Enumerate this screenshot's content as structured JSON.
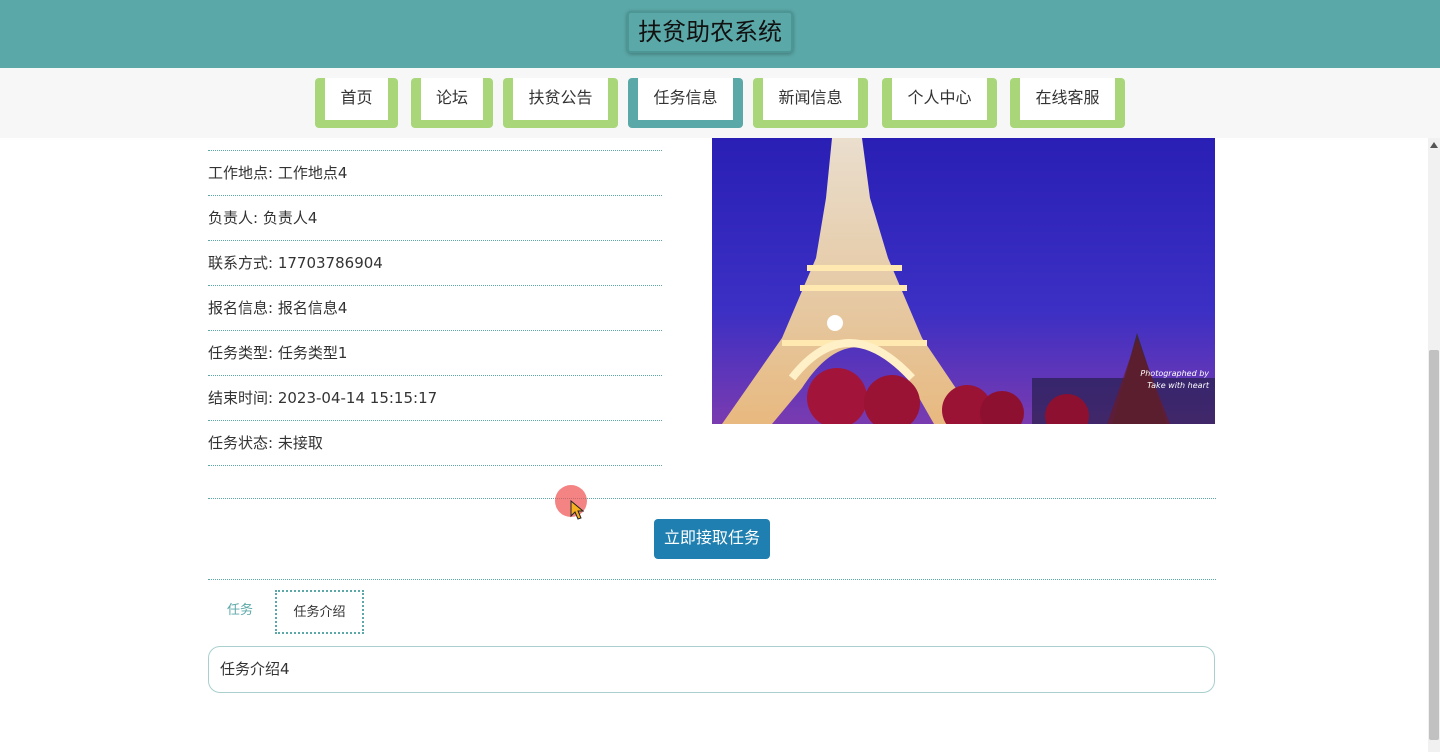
{
  "header": {
    "title": "扶贫助农系统"
  },
  "nav": {
    "items": [
      {
        "label": "首页",
        "active": false
      },
      {
        "label": "论坛",
        "active": false
      },
      {
        "label": "扶贫公告",
        "active": false
      },
      {
        "label": "任务信息",
        "active": true
      },
      {
        "label": "新闻信息",
        "active": false
      },
      {
        "label": "个人中心",
        "active": false
      },
      {
        "label": "在线客服",
        "active": false
      }
    ]
  },
  "task": {
    "fields": [
      {
        "label": "工作地点",
        "value": "工作地点4"
      },
      {
        "label": "负责人",
        "value": "负责人4"
      },
      {
        "label": "联系方式",
        "value": "17703786904"
      },
      {
        "label": "报名信息",
        "value": "报名信息4"
      },
      {
        "label": "任务类型",
        "value": "任务类型1"
      },
      {
        "label": "结束时间",
        "value": "2023-04-14 15:15:17"
      },
      {
        "label": "任务状态",
        "value": "未接取"
      }
    ],
    "photo_caption": [
      "Photographed by",
      "Take with heart"
    ],
    "accept_button": "立即接取任务"
  },
  "tabs": [
    {
      "label": "任务",
      "active": false
    },
    {
      "label": "任务介绍",
      "active": true
    }
  ],
  "description": "任务介绍4",
  "colors": {
    "primary": "#5ba8a8",
    "nav_border": "#a8d679",
    "button": "#1e7fb0"
  }
}
